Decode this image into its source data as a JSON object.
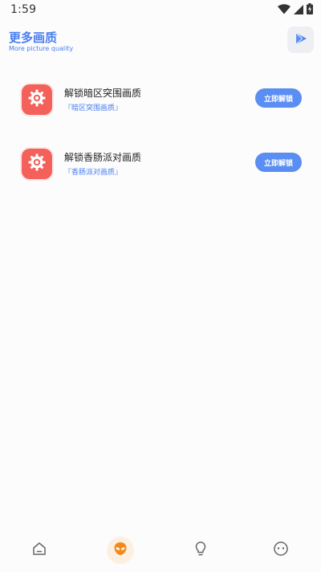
{
  "status_bar": {
    "time": "1:59",
    "icons": [
      "wifi-icon",
      "signal-icon",
      "battery-icon"
    ]
  },
  "header": {
    "title": "更多画质",
    "subtitle": "More picture quality",
    "action_icon": "play-store-icon"
  },
  "items": [
    {
      "icon": "settings-gear-icon",
      "title": "解锁暗区突围画质",
      "subtitle": "『暗区突围画质』",
      "button_label": "立即解锁"
    },
    {
      "icon": "settings-gear-icon",
      "title": "解锁香肠派对画质",
      "subtitle": "『香肠派对画质』",
      "button_label": "立即解锁"
    }
  ],
  "bottom_nav": {
    "items": [
      "home-icon",
      "alien-icon",
      "lightbulb-icon",
      "face-icon"
    ],
    "active_index": 1
  },
  "colors": {
    "accent": "#4a7ef0",
    "button": "#5a8ef2",
    "icon_bg": "#f4605a",
    "active_nav": "#f28a1a"
  }
}
